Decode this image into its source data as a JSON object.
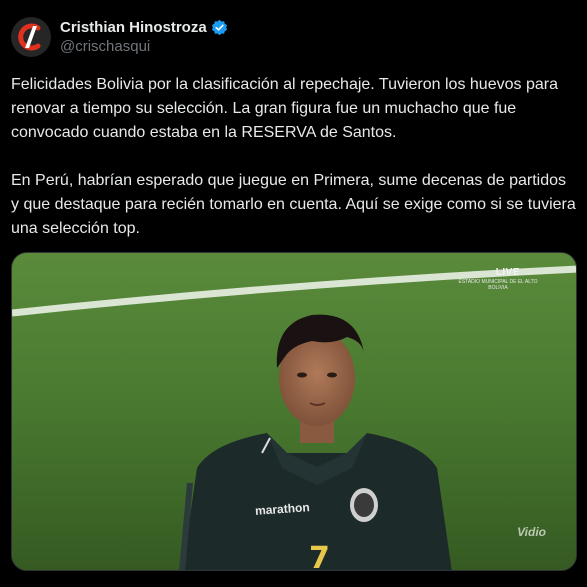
{
  "author": {
    "display_name": "Cristhian Hinostroza",
    "handle": "@crischasqui",
    "verified": true,
    "verified_color": "#1d9bf0",
    "avatar_icon": "logo-c-icon",
    "avatar_accent": "#e0301e"
  },
  "tweet": {
    "paragraphs": [
      "Felicidades Bolivia por la clasificación al repechaje. Tuvieron los huevos para renovar a tiempo su selección. La gran figura fue un muchacho que fue convocado cuando estaba en la RESERVA de Santos.",
      "En Perú, habrían esperado que juegue en Primera, sume decenas de partidos y que destaque para recién tomarlo en cuenta. Aquí se exige como si se tuviera una selección top."
    ]
  },
  "media": {
    "live_label": "LIVE",
    "venue_line": "ESTADIO MUNICIPAL DE EL ALTO",
    "venue_place": "BOLIVIA",
    "sponsor": "marathon",
    "jersey_number": "7",
    "watermark": "Vidio",
    "pitch_color": "#3f6a2a"
  }
}
